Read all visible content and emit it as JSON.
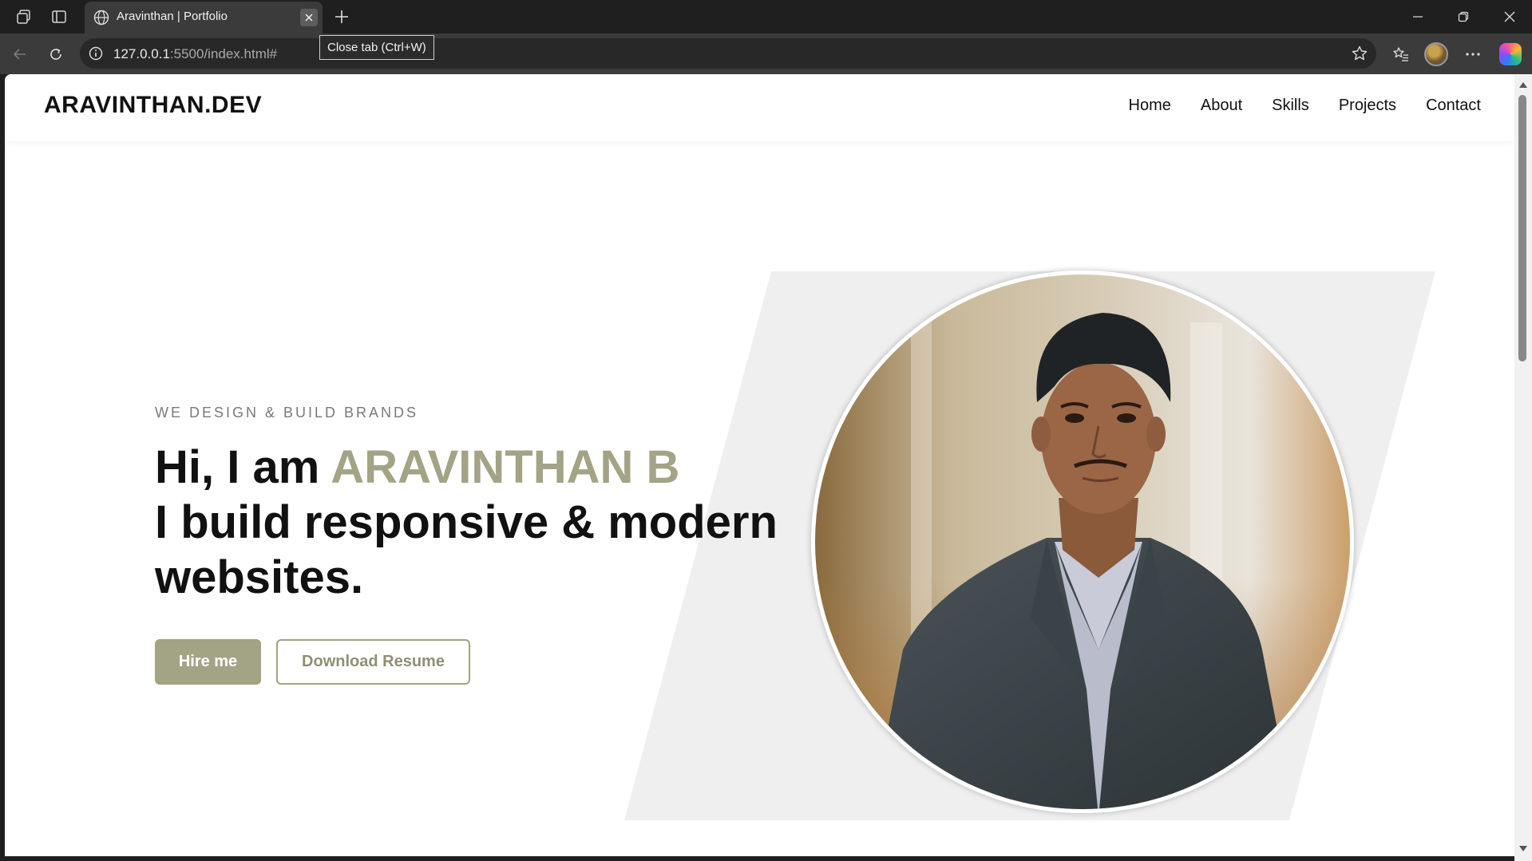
{
  "browser": {
    "tab_title": "Aravinthan | Portfolio",
    "tooltip": "Close tab (Ctrl+W)",
    "url_host": "127.0.0.1",
    "url_rest": ":5500/index.html#"
  },
  "site": {
    "logo": "ARAVINTHAN.DEV",
    "nav": [
      "Home",
      "About",
      "Skills",
      "Projects",
      "Contact"
    ],
    "hero": {
      "eyebrow": "WE DESIGN & BUILD BRANDS",
      "greeting": "Hi, I am ",
      "name": "ARAVINTHAN B",
      "line2": "I build responsive & modern",
      "line3": "websites.",
      "hire_label": "Hire me",
      "resume_label": "Download Resume"
    },
    "colors": {
      "accent": "#a3a386",
      "shape": "#efefef"
    }
  }
}
